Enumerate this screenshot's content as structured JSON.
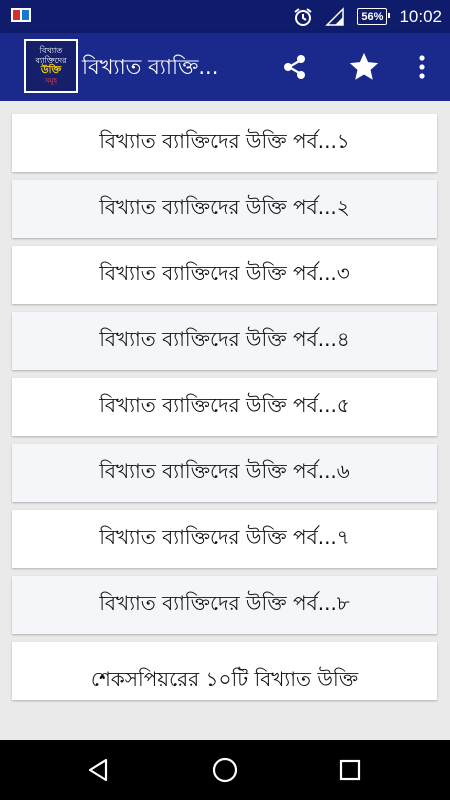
{
  "status_bar": {
    "battery": "56%",
    "time": "10:02"
  },
  "app_bar": {
    "logo_lines": [
      "বিখ্যাত",
      "ব্যাক্তিদের",
      "উক্তি",
      "সমূহ"
    ],
    "title": "বিখ্যাত ব্যাক্তি..."
  },
  "list": {
    "items": [
      {
        "label": "বিখ্যাত ব্যাক্তিদের উক্তি পর্ব...১"
      },
      {
        "label": "বিখ্যাত ব্যাক্তিদের উক্তি পর্ব...২"
      },
      {
        "label": "বিখ্যাত ব্যাক্তিদের উক্তি পর্ব...৩"
      },
      {
        "label": "বিখ্যাত ব্যাক্তিদের উক্তি পর্ব...৪"
      },
      {
        "label": "বিখ্যাত ব্যাক্তিদের উক্তি পর্ব...৫"
      },
      {
        "label": "বিখ্যাত ব্যাক্তিদের উক্তি পর্ব...৬"
      },
      {
        "label": "বিখ্যাত ব্যাক্তিদের উক্তি পর্ব...৭"
      },
      {
        "label": "বিখ্যাত ব্যাক্তিদের উক্তি পর্ব...৮"
      },
      {
        "label": "শেকসপিয়রের ১০টি বিখ্যাত উক্তি"
      }
    ]
  },
  "icons": {
    "status_left": "notification-app-icon",
    "alarm": "alarm-clock-icon",
    "signal": "signal-icon",
    "share": "share-icon",
    "favorite": "star-icon",
    "overflow": "more-vert-icon",
    "back": "back-icon",
    "home": "home-icon",
    "recents": "recents-icon"
  },
  "colors": {
    "status_bar": "#0f1b6b",
    "app_bar": "#1a2a8c",
    "list_background": "#eaeaea",
    "card": "#ffffff",
    "card_alt": "#f4f6f9",
    "nav_bar": "#000000"
  }
}
